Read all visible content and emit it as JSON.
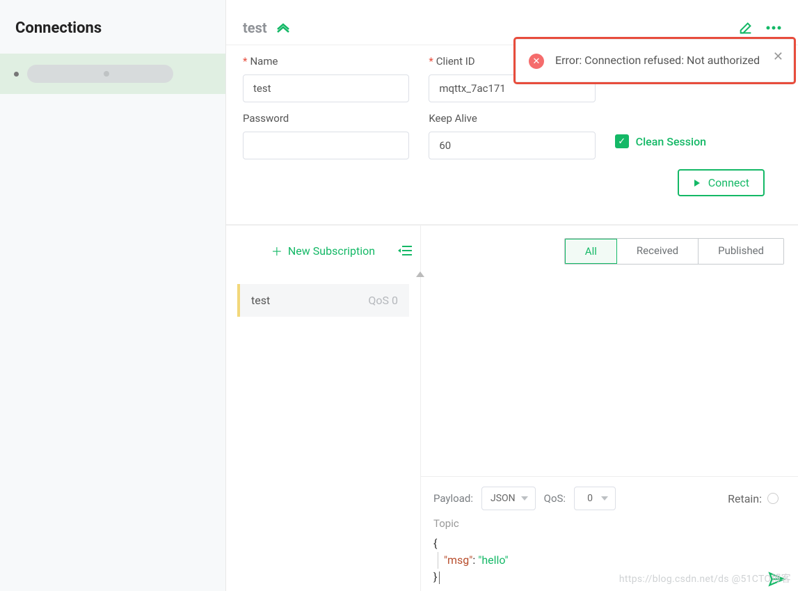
{
  "sidebar": {
    "title": "Connections",
    "items": [
      {
        "name": ""
      }
    ]
  },
  "header": {
    "tab_title": "test"
  },
  "form": {
    "name_label": "Name",
    "name_value": "test",
    "client_id_label": "Client ID",
    "client_id_value": "mqttx_7ac171",
    "password_label": "Password",
    "password_value": "",
    "keepalive_label": "Keep Alive",
    "keepalive_value": "60",
    "clean_session_label": "Clean Session",
    "connect_label": "Connect"
  },
  "subscriptions": {
    "new_btn": "New Subscription",
    "items": [
      {
        "topic": "test",
        "qos": "QoS 0"
      }
    ]
  },
  "messages": {
    "tabs": {
      "all": "All",
      "received": "Received",
      "published": "Published"
    },
    "compose": {
      "payload_label": "Payload:",
      "payload_format": "JSON",
      "qos_label": "QoS:",
      "qos_value": "0",
      "retain_label": "Retain:",
      "topic_label": "Topic",
      "body_key": "\"msg\"",
      "body_val": "\"hello\""
    }
  },
  "toast": {
    "text": "Error: Connection refused: Not authorized"
  },
  "watermark": "https://blog.csdn.net/ds  @51CTO博客"
}
